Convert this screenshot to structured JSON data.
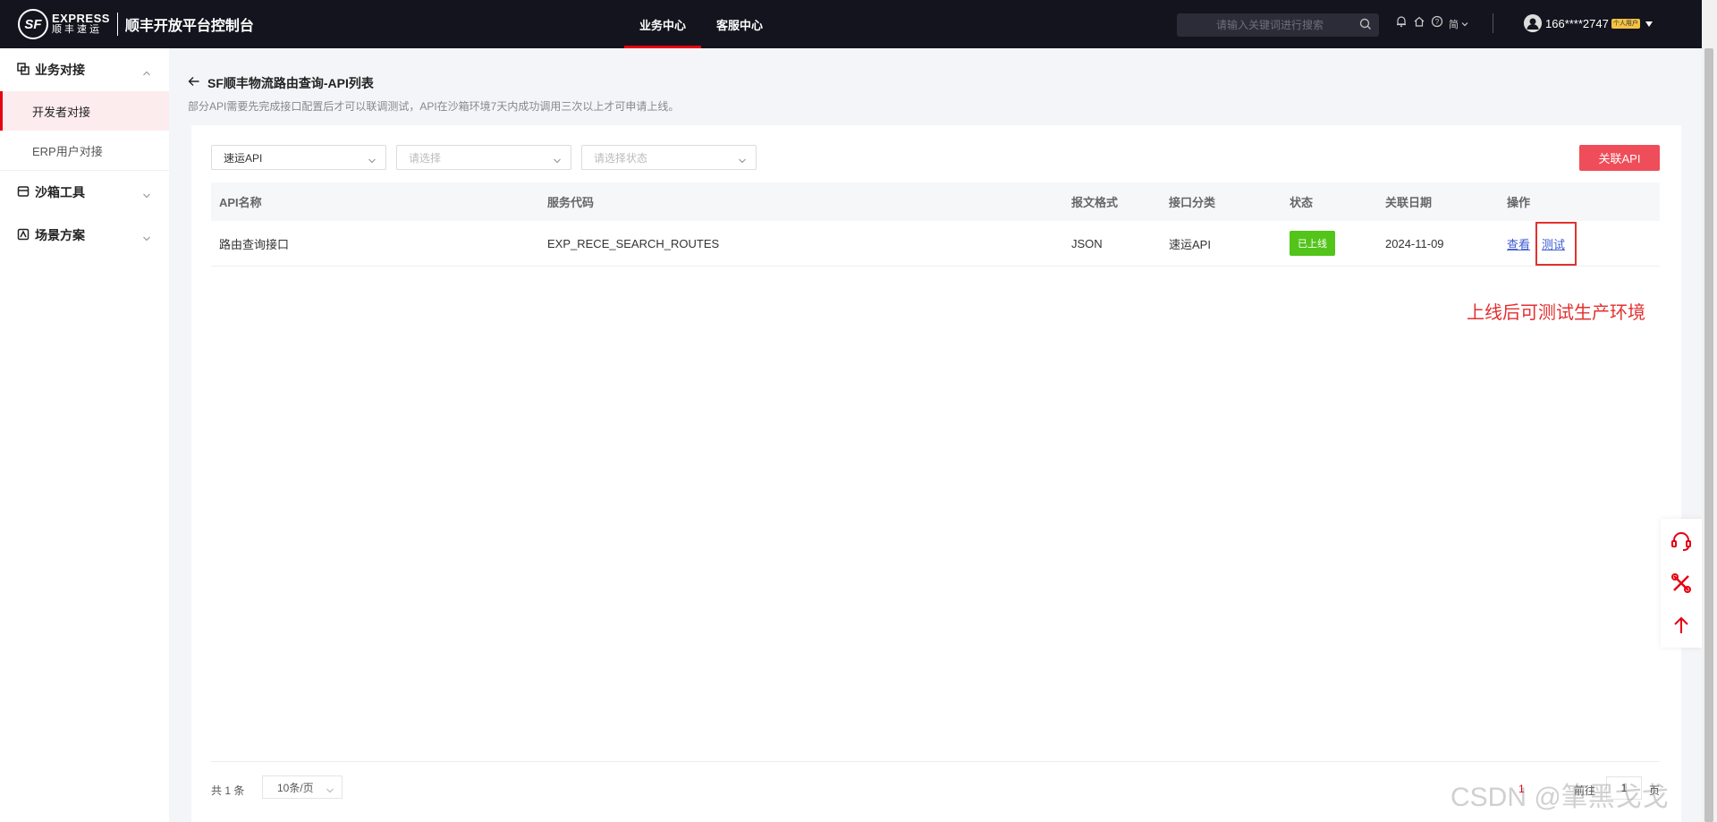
{
  "topbar": {
    "logo": {
      "mark": "SF",
      "en": "EXPRESS",
      "cn": "顺丰速运",
      "title": "顺丰开放平台控制台"
    },
    "nav": [
      {
        "label": "业务中心",
        "active": true
      },
      {
        "label": "客服中心",
        "active": false
      }
    ],
    "search": {
      "placeholder": "请输入关键词进行搜索",
      "value": ""
    },
    "icons": [
      "bell-icon",
      "home-icon",
      "help-icon",
      "language-icon"
    ],
    "language_label": "简",
    "user": {
      "name": "166****2747",
      "badge": "个人用户"
    }
  },
  "sidebar": {
    "groups": [
      {
        "label": "业务对接",
        "icon": "integration-icon",
        "expanded": true,
        "items": [
          {
            "label": "开发者对接",
            "active": true
          },
          {
            "label": "ERP用户对接",
            "active": false
          }
        ]
      },
      {
        "label": "沙箱工具",
        "icon": "sandbox-icon",
        "expanded": false,
        "items": []
      },
      {
        "label": "场景方案",
        "icon": "scenario-icon",
        "expanded": false,
        "items": []
      }
    ]
  },
  "page": {
    "title": "SF顺丰物流路由查询-API列表",
    "description": "部分API需要先完成接口配置后才可以联调测试，API在沙箱环境7天内成功调用三次以上才可申请上线。"
  },
  "filters": {
    "type": {
      "value": "速运API"
    },
    "select2": {
      "placeholder": "请选择"
    },
    "status": {
      "placeholder": "请选择状态"
    },
    "link_button": "关联API"
  },
  "table": {
    "columns": [
      "API名称",
      "服务代码",
      "报文格式",
      "接口分类",
      "状态",
      "关联日期",
      "操作"
    ],
    "rows": [
      {
        "name": "路由查询接口",
        "code": "EXP_RECE_SEARCH_ROUTES",
        "format": "JSON",
        "category": "速运API",
        "status": "已上线",
        "date": "2024-11-09",
        "actions": [
          "查看",
          "测试"
        ]
      }
    ]
  },
  "annotation": "上线后可测试生产环境",
  "pagination": {
    "total": "共 1 条",
    "page_size": "10条/页",
    "current_page": "1",
    "goto_label": "前往",
    "goto_value": "1",
    "unit": "页"
  },
  "float_tools": [
    "headset-icon",
    "tools-icon",
    "arrow-up-icon"
  ],
  "watermark": "CSDN @筆黑戈戈",
  "colors": {
    "brand": "#e60012",
    "button": "#ef4d59",
    "status_online": "#52c41a",
    "link": "#3c5ad0",
    "annotation": "#e33030"
  }
}
